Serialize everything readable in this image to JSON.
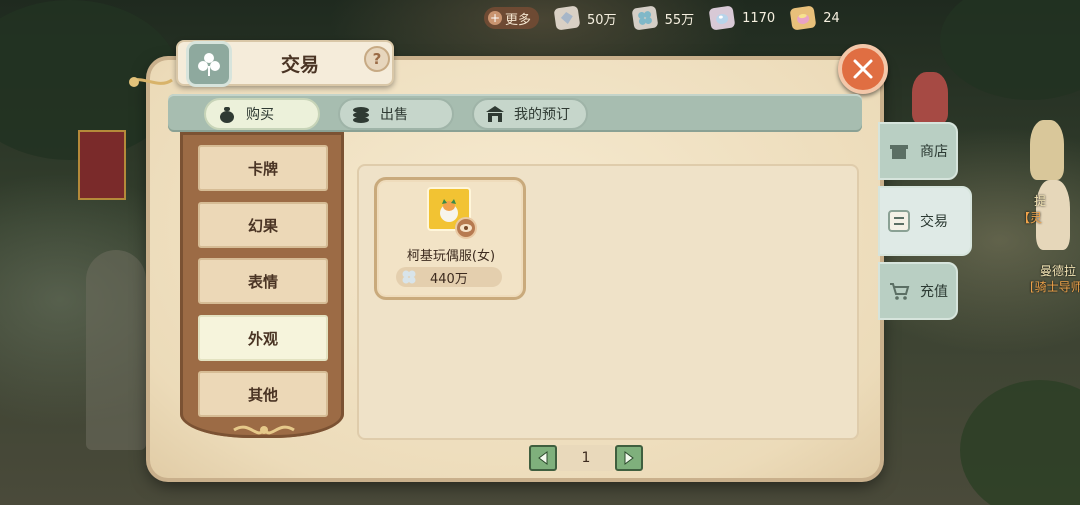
{
  "topbar": {
    "more_label": "更多",
    "resources": [
      {
        "icon": "silver-crystal-icon",
        "value": "50万"
      },
      {
        "icon": "clover-coin-icon",
        "value": "55万"
      },
      {
        "icon": "pearl-gem-icon",
        "value": "1170"
      },
      {
        "icon": "pink-gold-gem-icon",
        "value": "24"
      }
    ]
  },
  "window": {
    "title": "交易",
    "help_label": "?",
    "tabs": [
      {
        "label": "购买",
        "icon": "money-bag-icon",
        "active": true
      },
      {
        "label": "出售",
        "icon": "coin-stack-icon",
        "active": false
      },
      {
        "label": "我的预订",
        "icon": "shop-stall-icon",
        "active": false
      }
    ],
    "categories": [
      {
        "label": "卡牌",
        "active": false
      },
      {
        "label": "幻果",
        "active": false
      },
      {
        "label": "表情",
        "active": false
      },
      {
        "label": "外观",
        "active": true
      },
      {
        "label": "其他",
        "active": false
      }
    ],
    "items": [
      {
        "name": "柯基玩偶服(女)",
        "price": "440万",
        "icon": "corgi-costume-icon"
      }
    ],
    "pagination": {
      "page": "1"
    }
  },
  "side_nav": [
    {
      "label": "商店",
      "icon": "shop-icon",
      "active": false
    },
    {
      "label": "交易",
      "icon": "trade-icon",
      "active": true
    },
    {
      "label": "充值",
      "icon": "cart-icon",
      "active": false
    }
  ],
  "npc_labels": [
    "提",
    "【灵",
    "曼德拉",
    "[骑士导师"
  ],
  "colors": {
    "accent_close": "#e06e42",
    "tab_green": "#a7bdb0",
    "parchment": "#f0e2c6",
    "sidebar_brown": "#9c6b45",
    "page_button_green": "#7fb07c"
  }
}
